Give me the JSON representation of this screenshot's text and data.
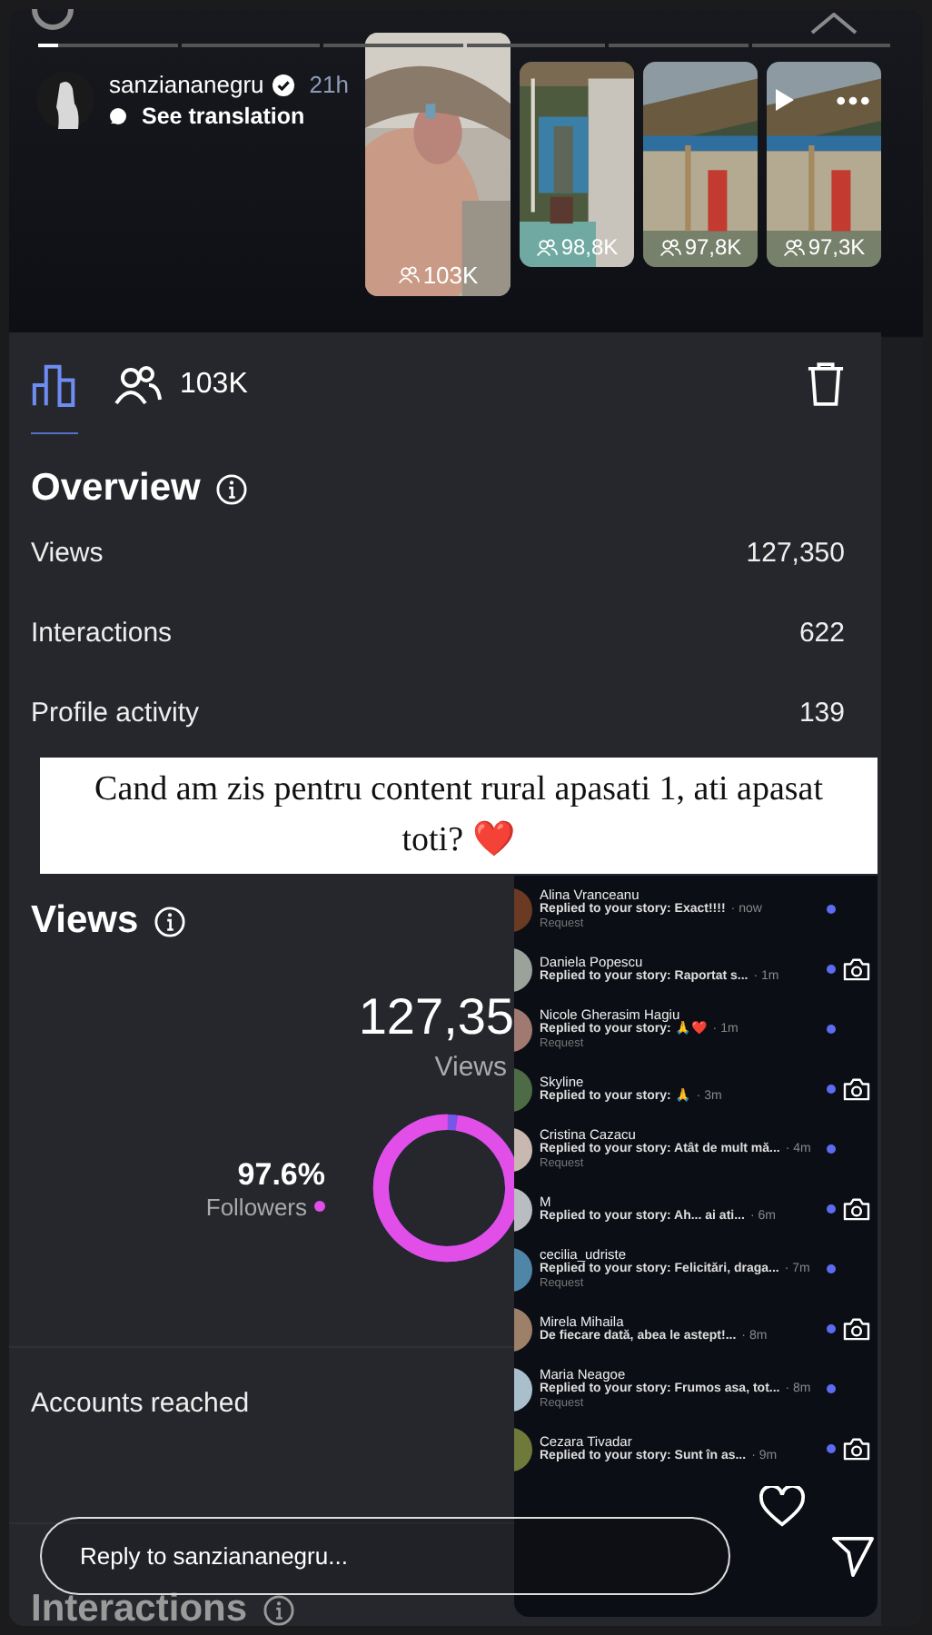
{
  "story": {
    "progress": [
      {
        "level": 0.15
      },
      {
        "level": 0
      },
      {
        "level": 0
      },
      {
        "level": 0
      },
      {
        "level": 0
      },
      {
        "level": 0
      }
    ],
    "username": "sanziananegru",
    "verified": true,
    "time": "21h",
    "translation_link": "See translation"
  },
  "thumbnails": [
    {
      "viewers": "103K",
      "selected": true,
      "kind": "portrait"
    },
    {
      "viewers": "98,8K",
      "selected": false,
      "kind": "porch"
    },
    {
      "viewers": "97,8K",
      "selected": false,
      "kind": "house"
    },
    {
      "viewers": "97,3K",
      "selected": false,
      "kind": "house"
    }
  ],
  "insights": {
    "tabs": [
      {
        "kind": "chart",
        "selected": true
      },
      {
        "kind": "viewers",
        "label": "103K",
        "selected": false
      }
    ],
    "overview": {
      "title": "Overview",
      "rows": [
        {
          "label": "Views",
          "value": "127,350"
        },
        {
          "label": "Interactions",
          "value": "622"
        },
        {
          "label": "Profile activity",
          "value": "139"
        }
      ]
    },
    "views": {
      "title": "Views",
      "total": "127,35",
      "total_label": "Views",
      "followers_share": "97.6%",
      "followers_label": "Followers",
      "donut": {
        "level": 0.976
      }
    },
    "accounts_reached": "Accounts reached",
    "interactions_title": "Interactions"
  },
  "caption": "Cand am zis pentru content rural apasati 1, ati apasat toti? ❤️",
  "messages": [
    {
      "name": "Alina Vranceanu",
      "text": "Replied to your story: Exact!!!!",
      "time": "· now",
      "request": "Request",
      "camera": false
    },
    {
      "name": "Daniela Popescu",
      "text": "Replied to your story: Raportat s...",
      "time": "· 1m",
      "camera": true
    },
    {
      "name": "Nicole Gherasim Hagiu",
      "text": "Replied to your story: 🙏❤️",
      "time": "· 1m",
      "request": "Request",
      "camera": false
    },
    {
      "name": "Skyline",
      "text": "Replied to your story: 🙏",
      "time": "· 3m",
      "camera": true
    },
    {
      "name": "Cristina Cazacu",
      "text": "Replied to your story: Atât de mult mă...",
      "time": "· 4m",
      "request": "Request",
      "camera": false
    },
    {
      "name": "M",
      "text": "Replied to your story: Ah... ai ati...",
      "time": "· 6m",
      "camera": true
    },
    {
      "name": "cecilia_udriste",
      "text": "Replied to your story: Felicitări, draga...",
      "time": "· 7m",
      "request": "Request",
      "camera": false
    },
    {
      "name": "Mirela Mihaila",
      "text": "De fiecare dată, abea le astept!...",
      "time": "· 8m",
      "camera": true
    },
    {
      "name": "Maria Neagoe",
      "text": "Replied to your story: Frumos asa, tot...",
      "time": "· 8m",
      "request": "Request",
      "camera": false
    },
    {
      "name": "Cezara Tivadar",
      "text": "Replied to your story: Sunt în as...",
      "time": "· 9m",
      "camera": true
    }
  ],
  "reply": {
    "placeholder": "Reply to sanziananegru..."
  }
}
